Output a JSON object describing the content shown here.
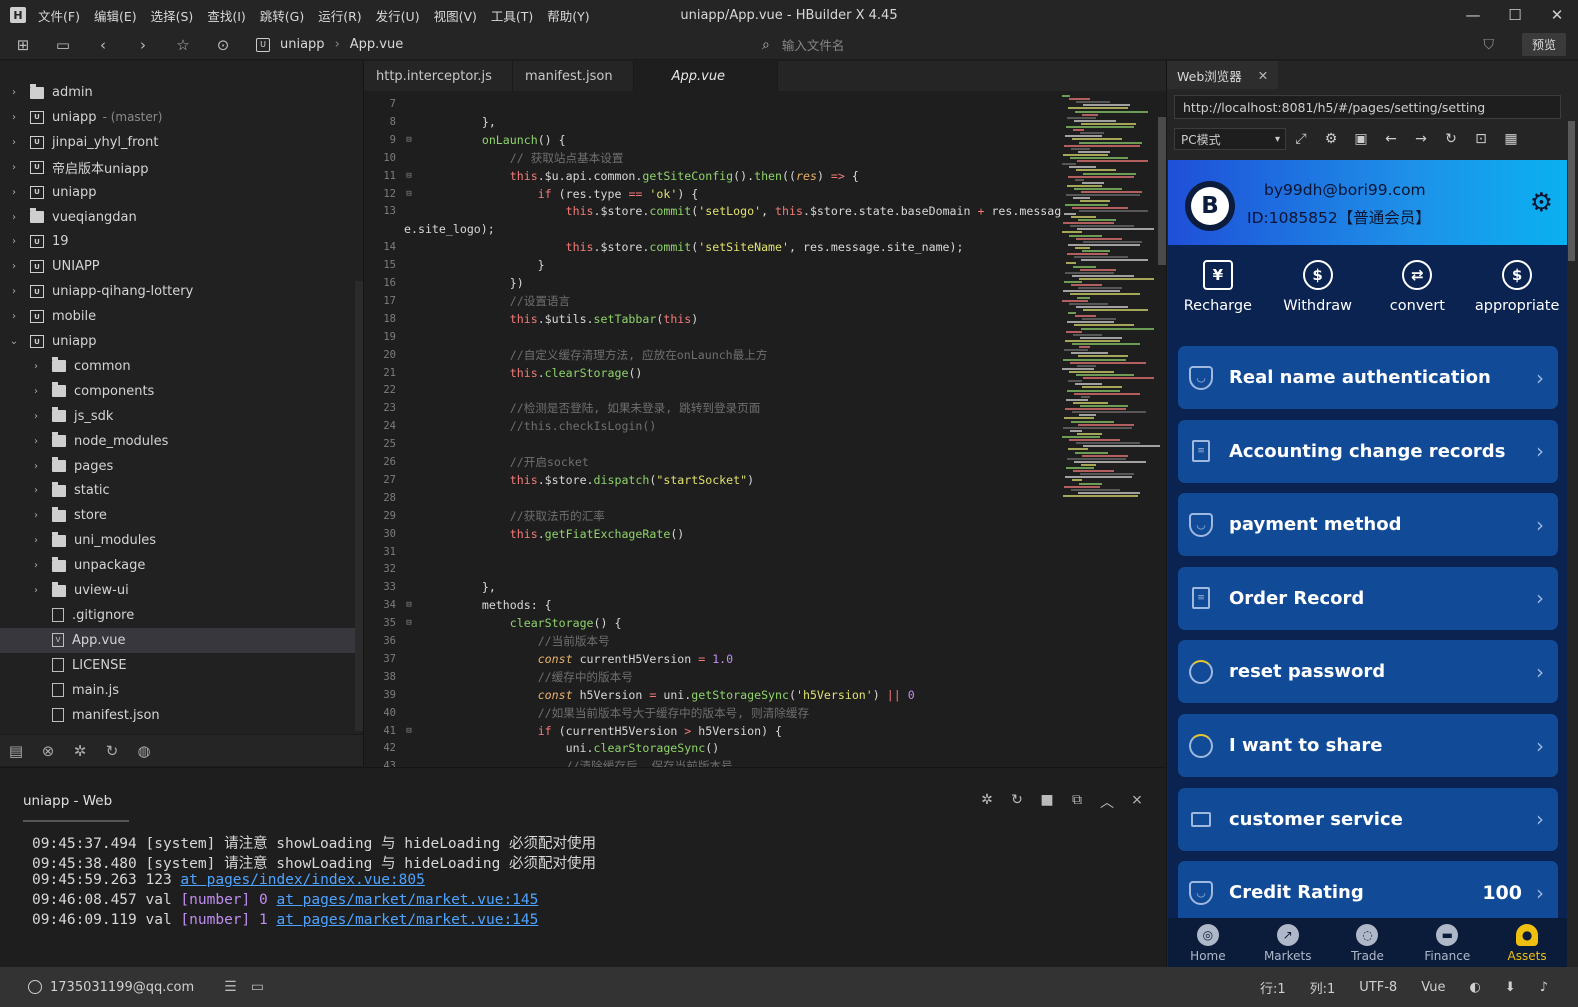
{
  "app": {
    "menu": [
      "文件(F)",
      "编辑(E)",
      "选择(S)",
      "查找(I)",
      "跳转(G)",
      "运行(R)",
      "发行(U)",
      "视图(V)",
      "工具(T)",
      "帮助(Y)"
    ],
    "title": "uniapp/App.vue - HBuilder X 4.45",
    "window_controls": [
      "minimize-icon",
      "maximize-icon",
      "close-icon"
    ]
  },
  "toolbar": {
    "crumb_project": "uniapp",
    "crumb_file": "App.vue",
    "file_search_placeholder": "输入文件名",
    "preview_label": "预览"
  },
  "explorer": {
    "items": [
      {
        "label": "admin",
        "type": "folder",
        "depth": 0,
        "chev": "›"
      },
      {
        "label": "uniapp",
        "type": "proj",
        "depth": 0,
        "chev": "›",
        "branch": "- (master)"
      },
      {
        "label": "jinpai_yhyl_front",
        "type": "proj",
        "depth": 0,
        "chev": "›"
      },
      {
        "label": "帝启版本uniapp",
        "type": "proj",
        "depth": 0,
        "chev": "›"
      },
      {
        "label": "uniapp",
        "type": "proj",
        "depth": 0,
        "chev": "›"
      },
      {
        "label": "vueqiangdan",
        "type": "folder",
        "depth": 0,
        "chev": "›"
      },
      {
        "label": "19",
        "type": "proj",
        "depth": 0,
        "chev": "›"
      },
      {
        "label": "UNIAPP",
        "type": "proj",
        "depth": 0,
        "chev": "›"
      },
      {
        "label": "uniapp-qihang-lottery",
        "type": "proj",
        "depth": 0,
        "chev": "›"
      },
      {
        "label": "mobile",
        "type": "proj",
        "depth": 0,
        "chev": "›"
      },
      {
        "label": "uniapp",
        "type": "proj",
        "depth": 0,
        "chev": "⌄"
      },
      {
        "label": "common",
        "type": "folder",
        "depth": 1,
        "chev": "›"
      },
      {
        "label": "components",
        "type": "folder",
        "depth": 1,
        "chev": "›"
      },
      {
        "label": "js_sdk",
        "type": "folder",
        "depth": 1,
        "chev": "›"
      },
      {
        "label": "node_modules",
        "type": "folder",
        "depth": 1,
        "chev": "›"
      },
      {
        "label": "pages",
        "type": "folder",
        "depth": 1,
        "chev": "›"
      },
      {
        "label": "static",
        "type": "folder",
        "depth": 1,
        "chev": "›"
      },
      {
        "label": "store",
        "type": "folder",
        "depth": 1,
        "chev": "›"
      },
      {
        "label": "uni_modules",
        "type": "folder",
        "depth": 1,
        "chev": "›"
      },
      {
        "label": "unpackage",
        "type": "folder",
        "depth": 1,
        "chev": "›"
      },
      {
        "label": "uview-ui",
        "type": "folder",
        "depth": 1,
        "chev": "›"
      },
      {
        "label": ".gitignore",
        "type": "file",
        "depth": 1,
        "chev": ""
      },
      {
        "label": "App.vue",
        "type": "vue",
        "depth": 1,
        "chev": "",
        "selected": true
      },
      {
        "label": "LICENSE",
        "type": "file",
        "depth": 1,
        "chev": ""
      },
      {
        "label": "main.js",
        "type": "file",
        "depth": 1,
        "chev": ""
      },
      {
        "label": "manifest.json",
        "type": "file",
        "depth": 1,
        "chev": ""
      }
    ]
  },
  "editor": {
    "tabs": [
      {
        "label": "http.interceptor.js",
        "active": false
      },
      {
        "label": "manifest.json",
        "active": false
      },
      {
        "label": "App.vue",
        "active": true
      }
    ],
    "lines": [
      {
        "n": "7",
        "fold": "",
        "html": ""
      },
      {
        "n": "8",
        "fold": "",
        "html": "        },"
      },
      {
        "n": "9",
        "fold": "⊟",
        "html": "        <span class='f'>onLaunch</span>() {"
      },
      {
        "n": "10",
        "fold": "",
        "html": "            <span class='c'>// 获取站点基本设置</span>"
      },
      {
        "n": "11",
        "fold": "⊟",
        "html": "            <span class='k'>this</span>.$u.api.common.<span class='f'>getSiteConfig</span>().<span class='f'>then</span>((<span class='it'>res</span>) <span class='k'>=></span> {"
      },
      {
        "n": "12",
        "fold": "⊟",
        "html": "                <span class='k'>if</span> (res.type <span class='k'>==</span> <span class='s'>'ok'</span>) {"
      },
      {
        "n": "13",
        "fold": "",
        "html": "                    <span class='k'>this</span>.$store.<span class='f'>commit</span>(<span class='s'>'setLogo'</span>, <span class='k'>this</span>.$store.state.baseDomain <span class='k'>+</span> res.messag"
      },
      {
        "n": "",
        "fold": "",
        "html": "e.site_logo);",
        "wrap": true
      },
      {
        "n": "14",
        "fold": "",
        "html": "                    <span class='k'>this</span>.$store.<span class='f'>commit</span>(<span class='s'>'setSiteName'</span>, res.message.site_name);"
      },
      {
        "n": "15",
        "fold": "",
        "html": "                }"
      },
      {
        "n": "16",
        "fold": "",
        "html": "            })"
      },
      {
        "n": "17",
        "fold": "",
        "html": "            <span class='c'>//设置语言</span>"
      },
      {
        "n": "18",
        "fold": "",
        "html": "            <span class='k'>this</span>.$utils.<span class='f'>setTabbar</span>(<span class='k'>this</span>)"
      },
      {
        "n": "19",
        "fold": "",
        "html": ""
      },
      {
        "n": "20",
        "fold": "",
        "html": "            <span class='c'>//自定义缓存清理方法, 应放在onLaunch最上方</span>"
      },
      {
        "n": "21",
        "fold": "",
        "html": "            <span class='k'>this</span>.<span class='f'>clearStorage</span>()"
      },
      {
        "n": "22",
        "fold": "",
        "html": ""
      },
      {
        "n": "23",
        "fold": "",
        "html": "            <span class='c'>//检测是否登陆, 如果未登录, 跳转到登录页面</span>"
      },
      {
        "n": "24",
        "fold": "",
        "html": "            <span class='c'>//this.checkIsLogin()</span>"
      },
      {
        "n": "25",
        "fold": "",
        "html": ""
      },
      {
        "n": "26",
        "fold": "",
        "html": "            <span class='c'>//开启socket</span>"
      },
      {
        "n": "27",
        "fold": "",
        "html": "            <span class='k'>this</span>.$store.<span class='f'>dispatch</span>(<span class='s'>\"startSocket\"</span>)"
      },
      {
        "n": "28",
        "fold": "",
        "html": ""
      },
      {
        "n": "29",
        "fold": "",
        "html": "            <span class='c'>//获取法币的汇率</span>"
      },
      {
        "n": "30",
        "fold": "",
        "html": "            <span class='k'>this</span>.<span class='f'>getFiatExchageRate</span>()"
      },
      {
        "n": "31",
        "fold": "",
        "html": ""
      },
      {
        "n": "32",
        "fold": "",
        "html": ""
      },
      {
        "n": "33",
        "fold": "",
        "html": "        },"
      },
      {
        "n": "34",
        "fold": "⊟",
        "html": "        methods: {"
      },
      {
        "n": "35",
        "fold": "⊟",
        "html": "            <span class='f'>clearStorage</span>() {"
      },
      {
        "n": "36",
        "fold": "",
        "html": "                <span class='c'>//当前版本号</span>"
      },
      {
        "n": "37",
        "fold": "",
        "html": "                <span class='it'>const</span> currentH5Version <span class='k'>=</span> <span class='n'>1.0</span>"
      },
      {
        "n": "38",
        "fold": "",
        "html": "                <span class='c'>//缓存中的版本号</span>"
      },
      {
        "n": "39",
        "fold": "",
        "html": "                <span class='it'>const</span> h5Version <span class='k'>=</span> uni.<span class='f'>getStorageSync</span>(<span class='s'>'h5Version'</span>) <span class='k'>||</span> <span class='n'>0</span>"
      },
      {
        "n": "40",
        "fold": "",
        "html": "                <span class='c'>//如果当前版本号大于缓存中的版本号, 则清除缓存</span>"
      },
      {
        "n": "41",
        "fold": "⊟",
        "html": "                <span class='k'>if</span> (currentH5Version <span class='k'>></span> h5Version) {"
      },
      {
        "n": "42",
        "fold": "",
        "html": "                    uni.<span class='f'>clearStorageSync</span>()"
      },
      {
        "n": "43",
        "fold": "",
        "html": "                    <span class='c'>//清除缓存后, 保存当前版本号</span>"
      }
    ]
  },
  "console": {
    "tab": "uniapp - Web",
    "logs": [
      {
        "time": "09:45:37.494",
        "text": " [system] 请注意 showLoading 与 hideLoading 必须配对使用",
        "tag": "",
        "link": "",
        "prefix": ""
      },
      {
        "time": "09:45:38.480",
        "text": " [system] 请注意 showLoading 与 hideLoading 必须配对使用",
        "tag": "",
        "link": "",
        "prefix": ""
      },
      {
        "time": "09:45:59.263",
        "prefix": " 123 ",
        "tag": "",
        "text": "",
        "link": "at pages/index/index.vue:805"
      },
      {
        "time": "09:46:08.457",
        "prefix": " val ",
        "tag": "[number] 0",
        "text": " ",
        "link": "at pages/market/market.vue:145"
      },
      {
        "time": "09:46:09.119",
        "prefix": " val ",
        "tag": "[number] 1",
        "text": " ",
        "link": "at pages/market/market.vue:145"
      }
    ]
  },
  "browser": {
    "tab": "Web浏览器",
    "url": "http://localhost:8081/h5/#/pages/setting/setting",
    "mode": "PC模式",
    "app": {
      "email": "by99dh@bori99.com",
      "uid": "ID:1085852【普通会员】",
      "actions": [
        {
          "label": "Recharge",
          "icon": "recharge-icon",
          "glyph": "¥"
        },
        {
          "label": "Withdraw",
          "icon": "withdraw-icon",
          "glyph": "$"
        },
        {
          "label": "convert",
          "icon": "convert-icon",
          "glyph": "⇄"
        },
        {
          "label": "appropriate",
          "icon": "appropriate-icon",
          "glyph": "$"
        }
      ],
      "cards": [
        {
          "label": "Real name authentication",
          "icon": "shield",
          "value": ""
        },
        {
          "label": "Accounting change records",
          "icon": "doc",
          "value": ""
        },
        {
          "label": "payment method",
          "icon": "shield",
          "value": ""
        },
        {
          "label": "Order Record",
          "icon": "doc",
          "value": ""
        },
        {
          "label": "reset password",
          "icon": "ring",
          "value": ""
        },
        {
          "label": "I want to share",
          "icon": "ring",
          "value": ""
        },
        {
          "label": "customer service",
          "icon": "mail",
          "value": ""
        },
        {
          "label": "Credit Rating",
          "icon": "shield",
          "value": "100"
        }
      ],
      "tabbar": [
        {
          "label": "Home",
          "icon": "home-icon",
          "active": false
        },
        {
          "label": "Markets",
          "icon": "markets-icon",
          "active": false
        },
        {
          "label": "Trade",
          "icon": "trade-icon",
          "active": false
        },
        {
          "label": "Finance",
          "icon": "finance-icon",
          "active": false
        },
        {
          "label": "Assets",
          "icon": "assets-icon",
          "active": true
        }
      ]
    }
  },
  "statusbar": {
    "user": "1735031199@qq.com",
    "line": "行:1",
    "col": "列:1",
    "encoding": "UTF-8",
    "language": "Vue"
  },
  "colors": {
    "accent": "#f0c010",
    "card": "#114a96",
    "header_gradient_start": "#1f4fd8",
    "header_gradient_end": "#0ab1f0"
  }
}
